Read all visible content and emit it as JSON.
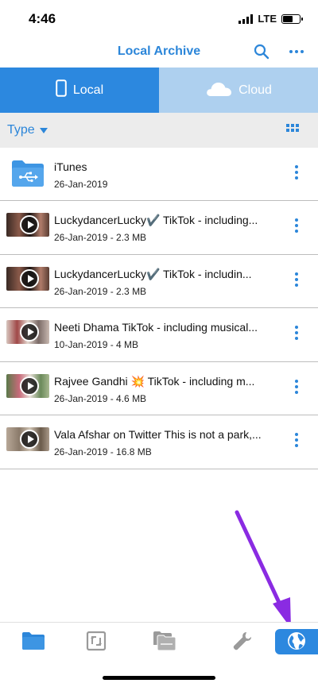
{
  "status_bar": {
    "time": "4:46",
    "network": "LTE",
    "battery_level": 0.6
  },
  "header": {
    "title": "Local Archive",
    "search_icon": "search-icon",
    "more_icon": "more-horizontal-icon",
    "accent_color": "#2c86d9"
  },
  "segments": [
    {
      "label": "Local",
      "icon": "phone-icon",
      "selected": true
    },
    {
      "label": "Cloud",
      "icon": "cloud-icon",
      "selected": false
    }
  ],
  "filter": {
    "label": "Type",
    "caret_icon": "caret-down-icon",
    "view_icon": "grid-view-icon"
  },
  "files": [
    {
      "name": "iTunes",
      "meta": "26-Jan-2019",
      "kind": "folder",
      "icon": "usb-folder-icon"
    },
    {
      "name": "LuckydancerLucky✔️  TikTok - including...",
      "meta": "26-Jan-2019 - 2.3 MB",
      "kind": "video",
      "icon": "play-icon"
    },
    {
      "name": "LuckydancerLucky✔️  TikTok - includin...",
      "meta": "26-Jan-2019 - 2.3 MB",
      "kind": "video",
      "icon": "play-icon"
    },
    {
      "name": "Neeti Dhama  TikTok - including musical...",
      "meta": "10-Jan-2019 - 4 MB",
      "kind": "video",
      "icon": "play-icon"
    },
    {
      "name": "Rajvee Gandhi 💥  TikTok - including m...",
      "meta": "26-Jan-2019 - 4.6 MB",
      "kind": "video",
      "icon": "play-icon"
    },
    {
      "name": "Vala Afshar on Twitter This is not a park,...",
      "meta": "26-Jan-2019 - 16.8 MB",
      "kind": "video",
      "icon": "play-icon"
    }
  ],
  "tab_bar": {
    "tabs": [
      {
        "icon": "folder-icon",
        "active": false
      },
      {
        "icon": "transfer-icon",
        "active": false
      },
      {
        "icon": "files-icon",
        "active": false
      },
      {
        "icon": "wrench-icon",
        "active": false
      },
      {
        "icon": "globe-icon",
        "active": true
      }
    ],
    "active_color": "#2c88df"
  },
  "annotation": {
    "icon": "pointer-arrow-icon",
    "color": "#8a2be2"
  }
}
